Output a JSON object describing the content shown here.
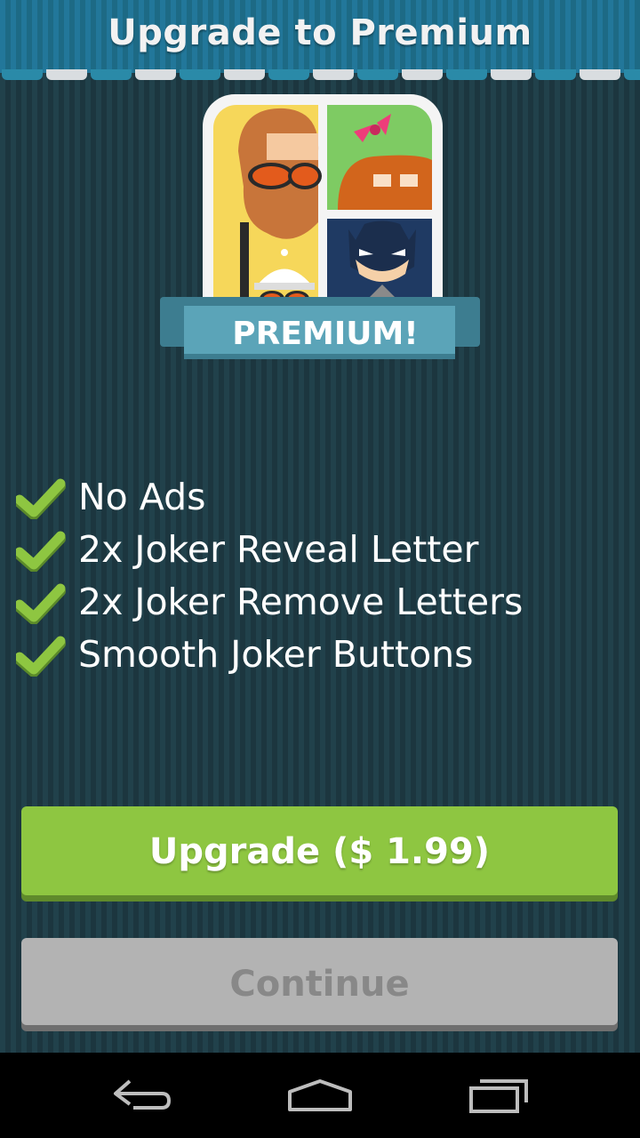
{
  "header": {
    "title": "Upgrade to Premium"
  },
  "badge": {
    "label": "PREMIUM!"
  },
  "features": [
    {
      "label": "No Ads",
      "icon": "check-icon"
    },
    {
      "label": "2x Joker Reveal Letter",
      "icon": "check-icon"
    },
    {
      "label": "2x Joker Remove Letters",
      "icon": "check-icon"
    },
    {
      "label": "Smooth Joker Buttons",
      "icon": "check-icon"
    }
  ],
  "buttons": {
    "upgrade_label": "Upgrade ($ 1.99)",
    "continue_label": "Continue"
  },
  "navbar": {
    "back_icon": "back-icon",
    "home_icon": "home-icon",
    "recents_icon": "recents-icon"
  },
  "colors": {
    "header": "#1e6f8a",
    "background": "#1f3b45",
    "upgrade_button": "#8ec641",
    "continue_button": "#b3b3b3",
    "badge": "#5ba4b8",
    "check": "#8ec641"
  }
}
